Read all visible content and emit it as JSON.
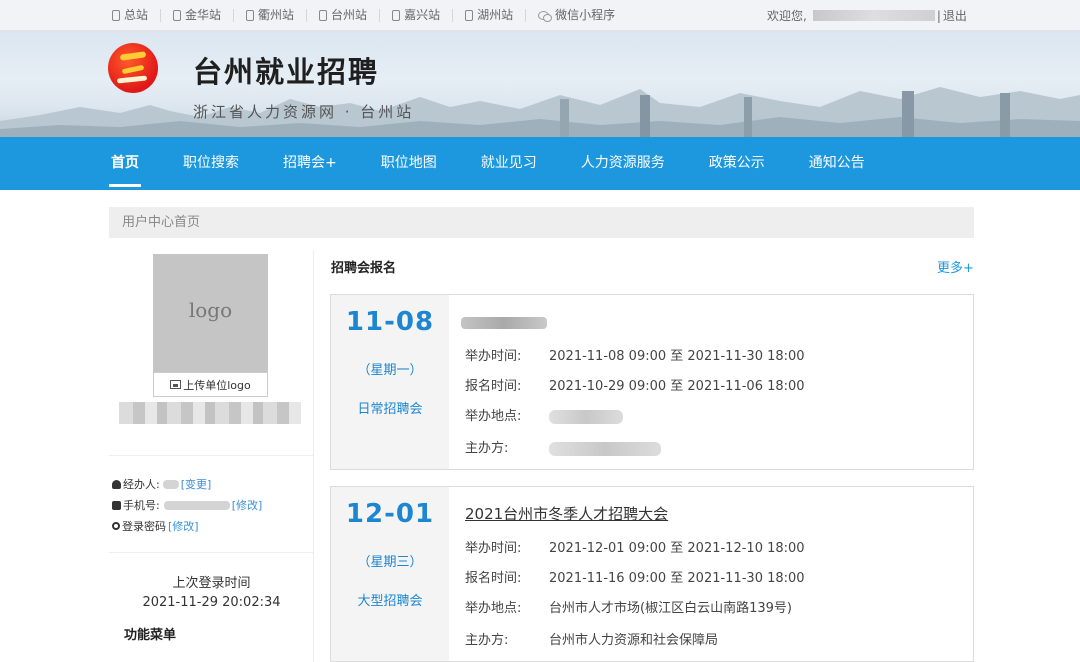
{
  "topbar": {
    "sites": [
      "总站",
      "金华站",
      "衢州站",
      "台州站",
      "嘉兴站",
      "湖州站"
    ],
    "wechat": "微信小程序",
    "welcome": "欢迎您,",
    "sep": "|",
    "logout": "退出"
  },
  "banner": {
    "title": "台州就业招聘",
    "subtitle": "浙江省人力资源网 · 台州站"
  },
  "nav": [
    "首页",
    "职位搜索",
    "招聘会+",
    "职位地图",
    "就业见习",
    "人力资源服务",
    "政策公示",
    "通知公告"
  ],
  "breadcrumb": "用户中心首页",
  "sidebar": {
    "logo_placeholder": "logo",
    "upload_label": "上传单位logo",
    "agent_label": "经办人:",
    "agent_change": "[变更]",
    "phone_label": "手机号:",
    "phone_edit": "[修改]",
    "password_label": "登录密码",
    "password_edit": "[修改]",
    "last_login_title": "上次登录时间",
    "last_login_time": "2021-11-29 20:02:34",
    "menu_title": "功能菜单"
  },
  "main": {
    "section_title": "招聘会报名",
    "more": "更多+",
    "labels": {
      "hold_time": "举办时间:",
      "signup_time": "报名时间:",
      "place": "举办地点:",
      "host": "主办方:"
    },
    "fairs": [
      {
        "date": "11-08",
        "weekday": "（星期一）",
        "type": "日常招聘会",
        "title": "",
        "hold_time": "2021-11-08 09:00 至 2021-11-30 18:00",
        "signup_time": "2021-10-29 09:00 至 2021-11-06 18:00",
        "place": "",
        "host": ""
      },
      {
        "date": "12-01",
        "weekday": "（星期三）",
        "type": "大型招聘会",
        "title": "2021台州市冬季人才招聘大会",
        "hold_time": "2021-12-01 09:00 至 2021-12-10 18:00",
        "signup_time": "2021-11-16 09:00 至 2021-11-30 18:00",
        "place": "台州市人才市场(椒江区白云山南路139号)",
        "host": "台州市人力资源和社会保障局"
      }
    ]
  }
}
